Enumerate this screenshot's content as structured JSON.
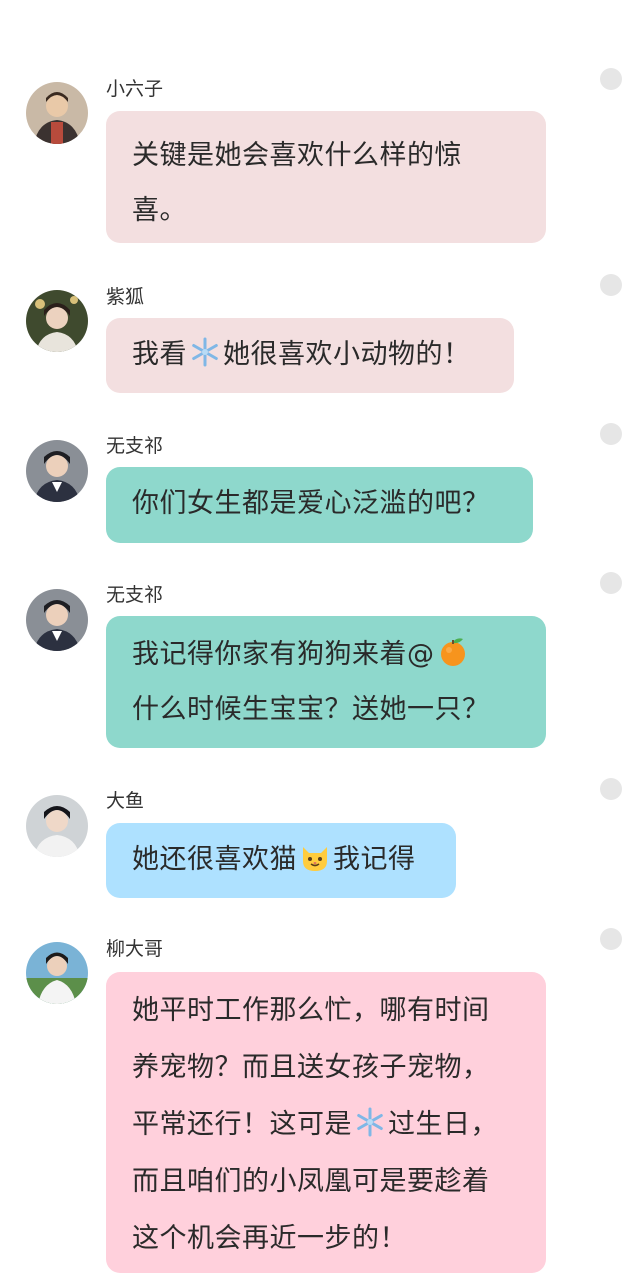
{
  "colors": {
    "pink_light": "#f3dfe0",
    "teal": "#8ed8cc",
    "blue": "#aee1ff",
    "pink": "#ffd0dc",
    "dot": "#e6e6e6"
  },
  "messages": [
    {
      "sender": "小六子",
      "lines": [
        [
          "关键是她会喜欢什么样的惊"
        ],
        [
          "喜。"
        ]
      ]
    },
    {
      "sender": "紫狐",
      "lines": [
        [
          "我看",
          {
            "emoji": "snowflake-icon"
          },
          "她很喜欢小动物的！"
        ]
      ]
    },
    {
      "sender": "无支祁",
      "lines": [
        [
          "你们女生都是爱心泛滥的吧？"
        ]
      ]
    },
    {
      "sender": "无支祁",
      "lines": [
        [
          "我记得你家有狗狗来着@",
          {
            "emoji": "tangerine-icon"
          }
        ],
        [
          "什么时候生宝宝？送她一只？"
        ]
      ]
    },
    {
      "sender": "大鱼",
      "lines": [
        [
          "她还很喜欢猫",
          {
            "emoji": "cat-face-icon"
          },
          "我记得"
        ]
      ]
    },
    {
      "sender": "柳大哥",
      "lines": [
        [
          "她平时工作那么忙，哪有时间"
        ],
        [
          "养宠物？而且送女孩子宠物，"
        ],
        [
          "平常还行！这可是",
          {
            "emoji": "snowflake-icon"
          },
          "过生日，"
        ],
        [
          "而且咱们的小凤凰可是要趁着"
        ],
        [
          "这个机会再近一步的！"
        ]
      ]
    }
  ]
}
